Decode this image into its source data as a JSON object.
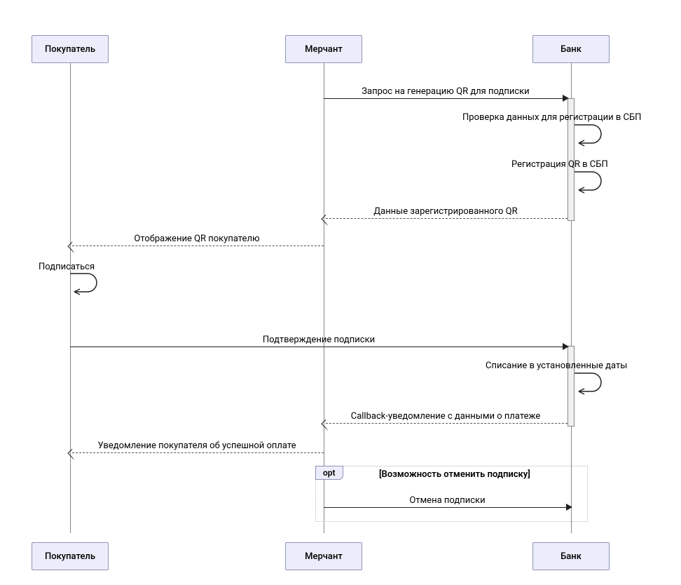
{
  "actors": {
    "buyer": "Покупатель",
    "merchant": "Мерчант",
    "bank": "Банк"
  },
  "messages": {
    "m1": "Запрос на генерацию QR для подписки",
    "m2": "Проверка данных для регистрации в СБП",
    "m3": "Регистрация QR в СБП",
    "m4": "Данные зарегистрированного QR",
    "m5": "Отображение QR покупателю",
    "m6": "Подписаться",
    "m7": "Подтверждение подписки",
    "m8": "Списание в установленные даты",
    "m9": "Callback-уведомление с данными о платеже",
    "m10": "Уведомление покупателя об успешной оплате",
    "m11": "Отмена подписки"
  },
  "fragment": {
    "tag": "opt",
    "condition": "[Возможность отменить подписку]"
  },
  "chart_data": {
    "type": "sequence-diagram",
    "actors": [
      "Покупатель",
      "Мерчант",
      "Банк"
    ],
    "interactions": [
      {
        "from": "Мерчант",
        "to": "Банк",
        "label": "Запрос на генерацию QR для подписки",
        "style": "solid"
      },
      {
        "from": "Банк",
        "to": "Банк",
        "label": "Проверка данных для регистрации в СБП",
        "style": "self"
      },
      {
        "from": "Банк",
        "to": "Банк",
        "label": "Регистрация QR в СБП",
        "style": "self"
      },
      {
        "from": "Банк",
        "to": "Мерчант",
        "label": "Данные зарегистрированного QR",
        "style": "dashed"
      },
      {
        "from": "Мерчант",
        "to": "Покупатель",
        "label": "Отображение QR покупателю",
        "style": "dashed"
      },
      {
        "from": "Покупатель",
        "to": "Покупатель",
        "label": "Подписаться",
        "style": "self"
      },
      {
        "from": "Покупатель",
        "to": "Банк",
        "label": "Подтверждение подписки",
        "style": "solid"
      },
      {
        "from": "Банк",
        "to": "Банк",
        "label": "Списание в установленные даты",
        "style": "self"
      },
      {
        "from": "Банк",
        "to": "Мерчант",
        "label": "Callback-уведомление с данными о платеже",
        "style": "dashed"
      },
      {
        "from": "Мерчант",
        "to": "Покупатель",
        "label": "Уведомление покупателя об успешной оплате",
        "style": "dashed"
      },
      {
        "fragment": "opt",
        "condition": "Возможность отменить подписку",
        "messages": [
          {
            "from": "Мерчант",
            "to": "Банк",
            "label": "Отмена подписки",
            "style": "solid"
          }
        ]
      }
    ]
  }
}
